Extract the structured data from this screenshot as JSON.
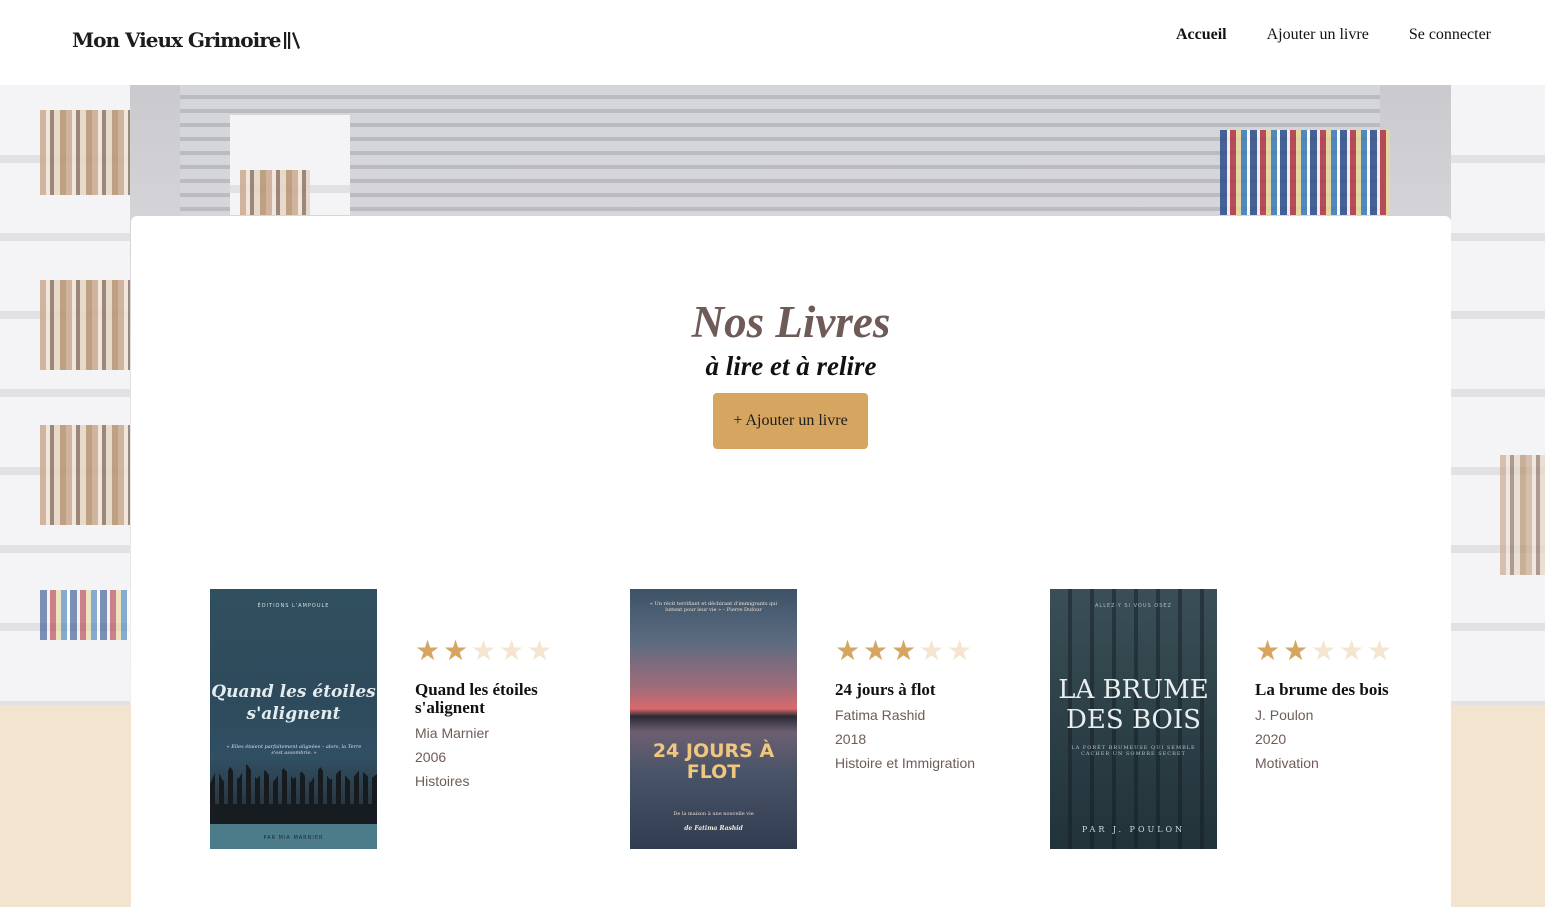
{
  "header": {
    "logo_text": "Mon Vieux Grimoire",
    "nav": [
      {
        "label": "Accueil",
        "active": true
      },
      {
        "label": "Ajouter un livre",
        "active": false
      },
      {
        "label": "Se connecter",
        "active": false
      }
    ]
  },
  "main": {
    "title": "Nos Livres",
    "subtitle": "à lire et à relire",
    "add_button_label": "+ Ajouter un livre"
  },
  "books": [
    {
      "title": "Quand les étoiles s'alignent",
      "author": "Mia Marnier",
      "year": "2006",
      "genre": "Histoires",
      "rating": 2,
      "max_rating": 5,
      "cover": {
        "publisher": "ÉDITIONS L'AMPOULE",
        "title": "Quand les étoiles s'alignent",
        "quote": "« Elles étaient parfaitement alignées – alors, la Terre s'est assombrie. »",
        "author_line": "PAR MIA MARNIER"
      }
    },
    {
      "title": "24 jours à flot",
      "author": "Fatima Rashid",
      "year": "2018",
      "genre": "Histoire et Immigration",
      "rating": 3,
      "max_rating": 5,
      "cover": {
        "quote": "« Un récit terrifiant et déchirant d'immigrants qui luttent pour leur vie » – Pierre Dufour",
        "title": "24 JOURS À FLOT",
        "subtitle": "De la maison à une nouvelle vie",
        "author_line": "de Fatima Rashid"
      }
    },
    {
      "title": "La brume des bois",
      "author": "J. Poulon",
      "year": "2020",
      "genre": "Motivation",
      "rating": 2,
      "max_rating": 5,
      "cover": {
        "publisher": "ALLEZ-Y SI VOUS OSEZ",
        "title": "LA BRUME DES BOIS",
        "subtitle": "LA FORÊT BRUMEUSE QUI SEMBLE CACHER UN SOMBRE SECRET",
        "author_line": "PAR J. POULON"
      }
    }
  ],
  "colors": {
    "accent": "#d6a55f",
    "title": "#6e5a57",
    "meta_text": "#6f5c58",
    "star_empty": "#f4e5cf",
    "footer_band": "#f2e4cf"
  }
}
